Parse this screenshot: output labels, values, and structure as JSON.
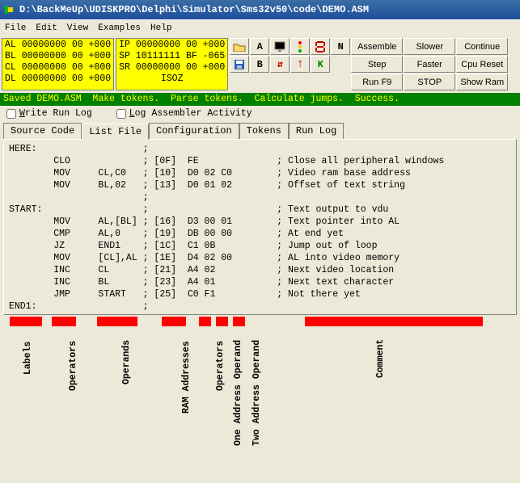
{
  "title": "D:\\BackMeUp\\UDISKPRO\\Delphi\\Simulator\\Sms32v50\\code\\DEMO.ASM",
  "menu": {
    "file": "File",
    "edit": "Edit",
    "view": "View",
    "examples": "Examples",
    "help": "Help"
  },
  "registers": {
    "al": "AL 00000000 00 +000",
    "bl": "BL 00000000 00 +000",
    "cl": "CL 00000000 00 +000",
    "dl": "DL 00000000 00 +000",
    "ip": "IP 00000000 00 +000",
    "sp": "SP 10111111 BF -065",
    "sr": "SR 00000000 00 +000",
    "flags": "ISOZ"
  },
  "toolbar": {
    "assemble": "Assemble",
    "step": "Step",
    "runf9": "Run F9",
    "slower": "Slower",
    "faster": "Faster",
    "stop": "STOP",
    "continue": "Continue",
    "cpureset": "Cpu Reset",
    "showram": "Show Ram",
    "a": "A",
    "b": "B",
    "k": "K",
    "n": "N"
  },
  "status": "Saved DEMO.ASM  Make tokens.  Parse tokens.  Calculate jumps.  Success.",
  "checks": {
    "writerunlog_pre": "W",
    "writerunlog": "rite Run Log",
    "logasm_pre": "L",
    "logasm": "og Assembler Activity"
  },
  "tabs": {
    "source": "Source Code",
    "list": "List File",
    "config": "Configuration",
    "tokens": "Tokens",
    "runlog": "Run Log"
  },
  "code": [
    "HERE:                   ;",
    "        CLO             ; [0F]  FE              ; Close all peripheral windows",
    "        MOV     CL,C0   ; [10]  D0 02 C0        ; Video ram base address",
    "        MOV     BL,02   ; [13]  D0 01 02        ; Offset of text string",
    "                        ;",
    "START:                  ;                       ; Text output to vdu",
    "        MOV     AL,[BL] ; [16]  D3 00 01        ; Text pointer into AL",
    "        CMP     AL,0    ; [19]  DB 00 00        ; At end yet",
    "        JZ      END1    ; [1C]  C1 0B           ; Jump out of loop",
    "        MOV     [CL],AL ; [1E]  D4 02 00        ; AL into video memory",
    "        INC     CL      ; [21]  A4 02           ; Next video location",
    "        INC     BL      ; [23]  A4 01           ; Next text character",
    "        JMP     START   ; [25]  C0 F1           ; Not there yet",
    "END1:                   ;"
  ],
  "annotations": {
    "labels": "Labels",
    "operators": "Operators",
    "operands": "Operands",
    "ram": "RAM Addresses",
    "operators2": "Operators",
    "oneaddr": "One Address Operand",
    "twoaddr": "Two Address Operand",
    "comment": "Comment"
  }
}
